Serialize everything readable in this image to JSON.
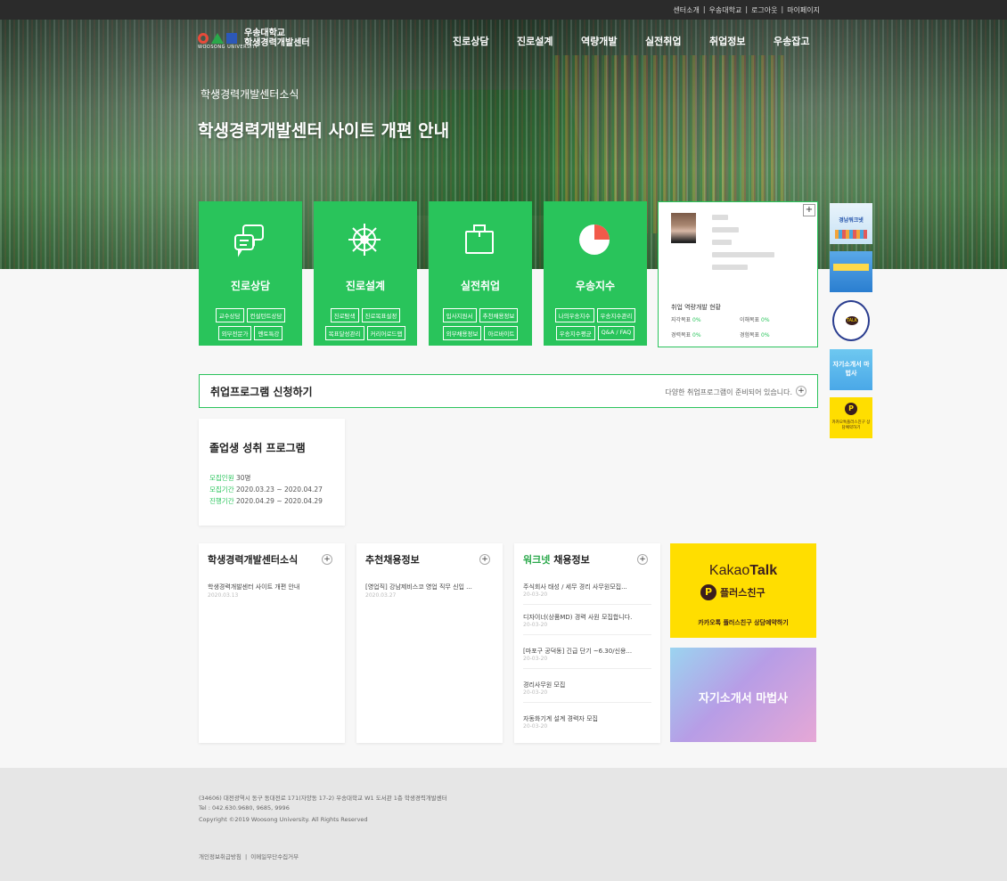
{
  "top_links": [
    "센터소개",
    "|",
    "우송대학교",
    "|",
    "로그아웃",
    "|",
    "마이페이지"
  ],
  "logo": {
    "line1": "우송대학교",
    "line2": "학생경력개발센터",
    "sub": "WOOSONG UNIVERSITY"
  },
  "nav": [
    "진로상담",
    "진로설계",
    "역량개발",
    "실전취업",
    "취업정보",
    "우송잡고"
  ],
  "hero": {
    "category": "학생경력개발센터소식",
    "title": "학생경력개발센터 사이트 개편 안내"
  },
  "cards": [
    {
      "title": "진로상담",
      "icon": "chat-bubbles-icon",
      "buttons": [
        "교수상담",
        "컨설턴트상담",
        "외부전문가",
        "멘토특강"
      ]
    },
    {
      "title": "진로설계",
      "icon": "ship-wheel-icon",
      "buttons": [
        "진로탐색",
        "진로목표설정",
        "목표달성관리",
        "커리어로드맵"
      ]
    },
    {
      "title": "실전취업",
      "icon": "briefcase-icon",
      "buttons": [
        "입사지원서",
        "추천채용정보",
        "외부채용정보",
        "아르바이트"
      ]
    },
    {
      "title": "우송지수",
      "icon": "pie-chart-icon",
      "buttons": [
        "나의우송지수",
        "우송지수관리",
        "우송지수평균",
        "Q&A / FAQ"
      ]
    }
  ],
  "profile": {
    "status_title": "취업 역량개발 현황",
    "stats": [
      {
        "label": "지각목표",
        "value": "0%"
      },
      {
        "label": "이해목표",
        "value": "0%"
      },
      {
        "label": "경력목표",
        "value": "0%"
      },
      {
        "label": "경험목표",
        "value": "0%"
      }
    ]
  },
  "side_banners": [
    {
      "name": "side-banner-1",
      "label": "경남워크넷"
    },
    {
      "name": "side-banner-2",
      "label": ""
    },
    {
      "name": "side-banner-3",
      "label": "TALK"
    },
    {
      "name": "side-banner-4",
      "label": "자기소개서 마법사"
    },
    {
      "name": "side-banner-5",
      "label": "카카오톡플러스친구 상담예약하기"
    }
  ],
  "apply": {
    "title": "취업프로그램 신청하기",
    "desc": "다양한 취업프로그램이 준비되어 있습니다.",
    "plus": "+"
  },
  "program": {
    "title": "졸업생 성취 프로그램",
    "rows": [
      {
        "label": "모집인원",
        "value": "30명"
      },
      {
        "label": "모집기간",
        "value": "2020.03.23 ~ 2020.04.27"
      },
      {
        "label": "진행기간",
        "value": "2020.04.29 ~ 2020.04.29"
      }
    ]
  },
  "news": {
    "title": "학생경력개발센터소식",
    "items": [
      {
        "text": "학생경력개발센터 사이트 개편 안내",
        "date": "2020.03.13"
      }
    ]
  },
  "recommend": {
    "title": "추천채용정보",
    "items": [
      {
        "text": "[영업직] 강남제비스코 영업 직무 신입 ...",
        "date": "2020.03.27"
      }
    ]
  },
  "worknet": {
    "title_green": "워크넷",
    "title_rest": " 채용정보",
    "items": [
      {
        "text": "주식회사 태성 / 세무 경리 사무원모집...",
        "date": "20-03-20"
      },
      {
        "text": "디자이너(상품MD) 경력 사원 모집합니다.",
        "date": "20-03-20"
      },
      {
        "text": "[마포구 공덕동] 긴급 단기 ~6.30/신용...",
        "date": "20-03-20"
      },
      {
        "text": "경리사무원 모집",
        "date": "20-03-20"
      },
      {
        "text": "자동화기계 설계 경력자 모집",
        "date": "20-03-20"
      }
    ]
  },
  "kakao": {
    "brand_a": "Kakao",
    "brand_b": "Talk",
    "plus_friend": "플러스친구",
    "cta": "카카오톡 플러스친구 상담예약하기"
  },
  "magic": {
    "label": "자기소개서 마법사"
  },
  "footer": {
    "address": "(34606) 대전광역시 동구 동대전로 171(자양동 17-2) 우송대학교 W1 도서관 1층 학생경력개발센터",
    "tel": "Tel : 042.630.9680, 9685, 9996",
    "copyright": "Copyright ©2019 Woosong University. All Rights Reserved",
    "links": "개인정보취급방침  |  이메일무단수집거부"
  },
  "colors": {
    "green": "#29c45b",
    "kakao_yellow": "#ffde00",
    "dark": "#2b2b2b"
  }
}
